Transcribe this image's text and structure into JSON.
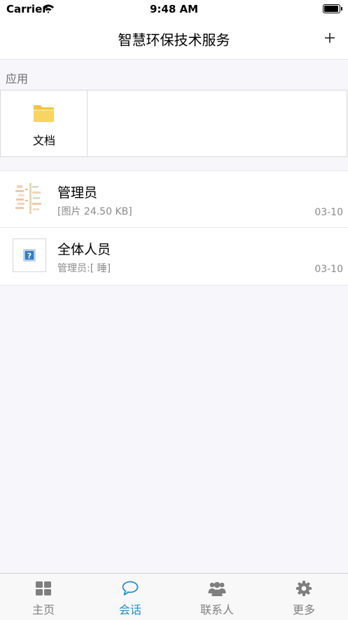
{
  "status_bar": {
    "carrier": "Carrier",
    "time": "9:48 AM"
  },
  "nav": {
    "title": "智慧环保技术服务",
    "add_icon": "plus-icon"
  },
  "apps_section": {
    "header": "应用",
    "items": [
      {
        "label": "文档",
        "icon": "folder-icon"
      }
    ]
  },
  "conversations": [
    {
      "name": "管理员",
      "preview": "[图片 24.50 KB]",
      "time": "03-10",
      "avatar": "image-thumbnail"
    },
    {
      "name": "全体人员",
      "preview": "管理员:[ 睡]",
      "time": "03-10",
      "avatar": "question-icon"
    }
  ],
  "tabs": [
    {
      "label": "主页",
      "icon": "grid-icon",
      "active": false
    },
    {
      "label": "会话",
      "icon": "chat-bubble-icon",
      "active": true
    },
    {
      "label": "联系人",
      "icon": "contacts-icon",
      "active": false
    },
    {
      "label": "更多",
      "icon": "gear-icon",
      "active": false
    }
  ],
  "colors": {
    "accent": "#1f8fcf",
    "inactive": "#7f7f7f",
    "background": "#f7f6fa"
  }
}
